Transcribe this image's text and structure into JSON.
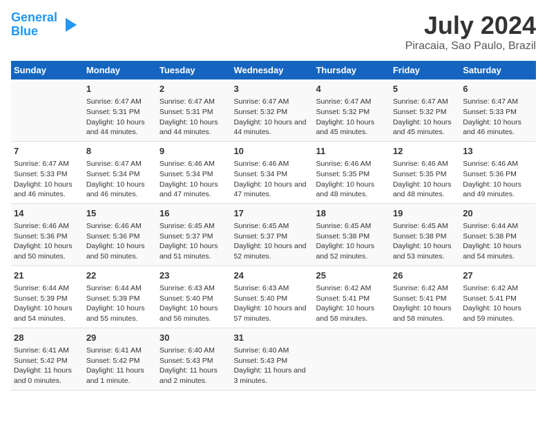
{
  "logo": {
    "line1": "General",
    "line2": "Blue"
  },
  "title": "July 2024",
  "subtitle": "Piracaia, Sao Paulo, Brazil",
  "headers": [
    "Sunday",
    "Monday",
    "Tuesday",
    "Wednesday",
    "Thursday",
    "Friday",
    "Saturday"
  ],
  "weeks": [
    [
      {
        "day": "",
        "sunrise": "",
        "sunset": "",
        "daylight": ""
      },
      {
        "day": "1",
        "sunrise": "Sunrise: 6:47 AM",
        "sunset": "Sunset: 5:31 PM",
        "daylight": "Daylight: 10 hours and 44 minutes."
      },
      {
        "day": "2",
        "sunrise": "Sunrise: 6:47 AM",
        "sunset": "Sunset: 5:31 PM",
        "daylight": "Daylight: 10 hours and 44 minutes."
      },
      {
        "day": "3",
        "sunrise": "Sunrise: 6:47 AM",
        "sunset": "Sunset: 5:32 PM",
        "daylight": "Daylight: 10 hours and 44 minutes."
      },
      {
        "day": "4",
        "sunrise": "Sunrise: 6:47 AM",
        "sunset": "Sunset: 5:32 PM",
        "daylight": "Daylight: 10 hours and 45 minutes."
      },
      {
        "day": "5",
        "sunrise": "Sunrise: 6:47 AM",
        "sunset": "Sunset: 5:32 PM",
        "daylight": "Daylight: 10 hours and 45 minutes."
      },
      {
        "day": "6",
        "sunrise": "Sunrise: 6:47 AM",
        "sunset": "Sunset: 5:33 PM",
        "daylight": "Daylight: 10 hours and 46 minutes."
      }
    ],
    [
      {
        "day": "7",
        "sunrise": "Sunrise: 6:47 AM",
        "sunset": "Sunset: 5:33 PM",
        "daylight": "Daylight: 10 hours and 46 minutes."
      },
      {
        "day": "8",
        "sunrise": "Sunrise: 6:47 AM",
        "sunset": "Sunset: 5:34 PM",
        "daylight": "Daylight: 10 hours and 46 minutes."
      },
      {
        "day": "9",
        "sunrise": "Sunrise: 6:46 AM",
        "sunset": "Sunset: 5:34 PM",
        "daylight": "Daylight: 10 hours and 47 minutes."
      },
      {
        "day": "10",
        "sunrise": "Sunrise: 6:46 AM",
        "sunset": "Sunset: 5:34 PM",
        "daylight": "Daylight: 10 hours and 47 minutes."
      },
      {
        "day": "11",
        "sunrise": "Sunrise: 6:46 AM",
        "sunset": "Sunset: 5:35 PM",
        "daylight": "Daylight: 10 hours and 48 minutes."
      },
      {
        "day": "12",
        "sunrise": "Sunrise: 6:46 AM",
        "sunset": "Sunset: 5:35 PM",
        "daylight": "Daylight: 10 hours and 48 minutes."
      },
      {
        "day": "13",
        "sunrise": "Sunrise: 6:46 AM",
        "sunset": "Sunset: 5:36 PM",
        "daylight": "Daylight: 10 hours and 49 minutes."
      }
    ],
    [
      {
        "day": "14",
        "sunrise": "Sunrise: 6:46 AM",
        "sunset": "Sunset: 5:36 PM",
        "daylight": "Daylight: 10 hours and 50 minutes."
      },
      {
        "day": "15",
        "sunrise": "Sunrise: 6:46 AM",
        "sunset": "Sunset: 5:36 PM",
        "daylight": "Daylight: 10 hours and 50 minutes."
      },
      {
        "day": "16",
        "sunrise": "Sunrise: 6:45 AM",
        "sunset": "Sunset: 5:37 PM",
        "daylight": "Daylight: 10 hours and 51 minutes."
      },
      {
        "day": "17",
        "sunrise": "Sunrise: 6:45 AM",
        "sunset": "Sunset: 5:37 PM",
        "daylight": "Daylight: 10 hours and 52 minutes."
      },
      {
        "day": "18",
        "sunrise": "Sunrise: 6:45 AM",
        "sunset": "Sunset: 5:38 PM",
        "daylight": "Daylight: 10 hours and 52 minutes."
      },
      {
        "day": "19",
        "sunrise": "Sunrise: 6:45 AM",
        "sunset": "Sunset: 5:38 PM",
        "daylight": "Daylight: 10 hours and 53 minutes."
      },
      {
        "day": "20",
        "sunrise": "Sunrise: 6:44 AM",
        "sunset": "Sunset: 5:38 PM",
        "daylight": "Daylight: 10 hours and 54 minutes."
      }
    ],
    [
      {
        "day": "21",
        "sunrise": "Sunrise: 6:44 AM",
        "sunset": "Sunset: 5:39 PM",
        "daylight": "Daylight: 10 hours and 54 minutes."
      },
      {
        "day": "22",
        "sunrise": "Sunrise: 6:44 AM",
        "sunset": "Sunset: 5:39 PM",
        "daylight": "Daylight: 10 hours and 55 minutes."
      },
      {
        "day": "23",
        "sunrise": "Sunrise: 6:43 AM",
        "sunset": "Sunset: 5:40 PM",
        "daylight": "Daylight: 10 hours and 56 minutes."
      },
      {
        "day": "24",
        "sunrise": "Sunrise: 6:43 AM",
        "sunset": "Sunset: 5:40 PM",
        "daylight": "Daylight: 10 hours and 57 minutes."
      },
      {
        "day": "25",
        "sunrise": "Sunrise: 6:42 AM",
        "sunset": "Sunset: 5:41 PM",
        "daylight": "Daylight: 10 hours and 58 minutes."
      },
      {
        "day": "26",
        "sunrise": "Sunrise: 6:42 AM",
        "sunset": "Sunset: 5:41 PM",
        "daylight": "Daylight: 10 hours and 58 minutes."
      },
      {
        "day": "27",
        "sunrise": "Sunrise: 6:42 AM",
        "sunset": "Sunset: 5:41 PM",
        "daylight": "Daylight: 10 hours and 59 minutes."
      }
    ],
    [
      {
        "day": "28",
        "sunrise": "Sunrise: 6:41 AM",
        "sunset": "Sunset: 5:42 PM",
        "daylight": "Daylight: 11 hours and 0 minutes."
      },
      {
        "day": "29",
        "sunrise": "Sunrise: 6:41 AM",
        "sunset": "Sunset: 5:42 PM",
        "daylight": "Daylight: 11 hours and 1 minute."
      },
      {
        "day": "30",
        "sunrise": "Sunrise: 6:40 AM",
        "sunset": "Sunset: 5:43 PM",
        "daylight": "Daylight: 11 hours and 2 minutes."
      },
      {
        "day": "31",
        "sunrise": "Sunrise: 6:40 AM",
        "sunset": "Sunset: 5:43 PM",
        "daylight": "Daylight: 11 hours and 3 minutes."
      },
      {
        "day": "",
        "sunrise": "",
        "sunset": "",
        "daylight": ""
      },
      {
        "day": "",
        "sunrise": "",
        "sunset": "",
        "daylight": ""
      },
      {
        "day": "",
        "sunrise": "",
        "sunset": "",
        "daylight": ""
      }
    ]
  ]
}
